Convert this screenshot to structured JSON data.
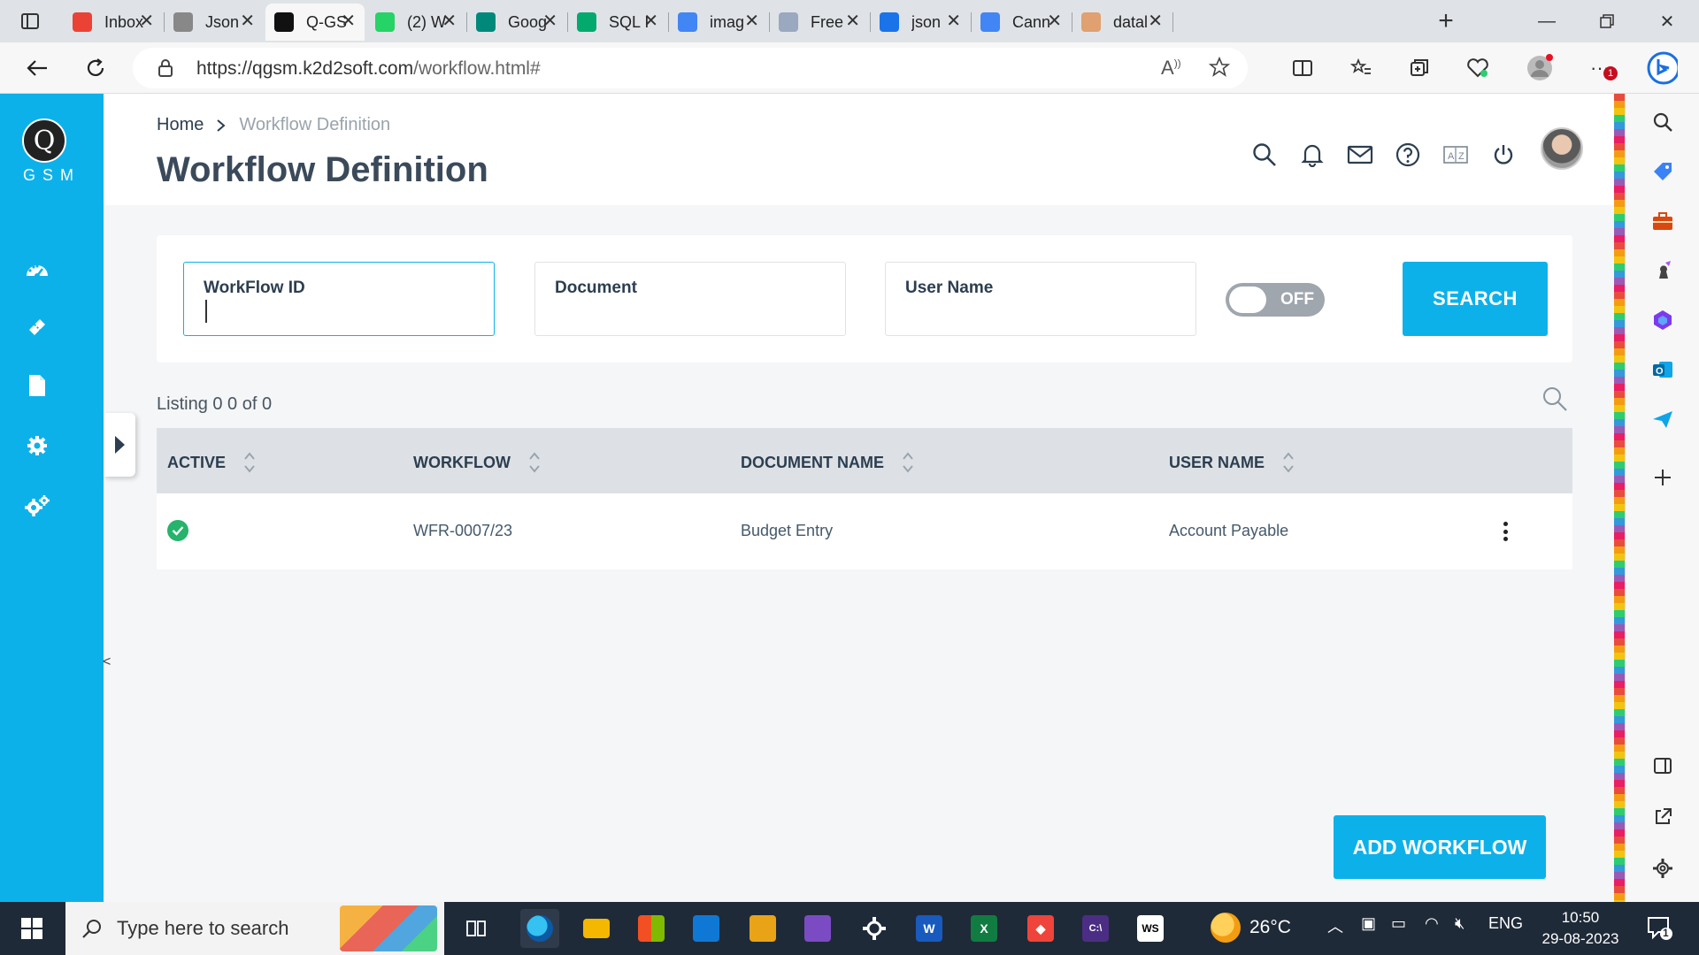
{
  "browser": {
    "tabs": [
      {
        "title": "Inbox",
        "icon": "gmail-icon",
        "color": "#ea4335"
      },
      {
        "title": "Json",
        "icon": "json-icon",
        "color": "#888888"
      },
      {
        "title": "Q-GS",
        "icon": "qgsm-icon",
        "color": "#111111",
        "active": true
      },
      {
        "title": "(2) W",
        "icon": "whatsapp-icon",
        "color": "#25d366"
      },
      {
        "title": "Goog",
        "icon": "google-meet-icon",
        "color": "#00897b"
      },
      {
        "title": "SQL I",
        "icon": "w3schools-icon",
        "color": "#04aa6d"
      },
      {
        "title": "imag",
        "icon": "search-tab-icon",
        "color": "#4285f4"
      },
      {
        "title": "Free",
        "icon": "rp-icon",
        "color": "#9aa8c0"
      },
      {
        "title": "json",
        "icon": "search-tab-icon",
        "color": "#1a73e8"
      },
      {
        "title": "Cann",
        "icon": "search-tab-icon",
        "color": "#4285f4"
      },
      {
        "title": "datal",
        "icon": "doc-tab-icon",
        "color": "#e0a070"
      }
    ],
    "url_host": "https://qgsm.k2d2soft.com",
    "url_path": "/workflow.html#",
    "notification_badge": "1"
  },
  "app": {
    "logo_letter": "Q",
    "logo_text": "GSM",
    "breadcrumb": {
      "home": "Home",
      "separator": ">",
      "current": "Workflow Definition"
    },
    "page_title": "Workflow Definition",
    "header_icons": [
      "search-icon",
      "bell-icon",
      "mail-icon",
      "help-icon",
      "translate-icon",
      "power-icon"
    ],
    "sidebar_icons": [
      "dashboard-icon",
      "ticket-icon",
      "document-icon",
      "settings-icon",
      "multi-settings-icon"
    ],
    "collapse_mark": "<"
  },
  "filters": {
    "workflow_id": {
      "label": "WorkFlow ID",
      "value": ""
    },
    "document": {
      "label": "Document",
      "value": ""
    },
    "user_name": {
      "label": "User Name",
      "value": ""
    },
    "toggle": {
      "state": "OFF"
    },
    "search_button": "SEARCH"
  },
  "listing": {
    "summary": "Listing 0 0 of 0",
    "columns": [
      "ACTIVE",
      "WORKFLOW",
      "DOCUMENT NAME",
      "USER NAME"
    ],
    "rows": [
      {
        "active": true,
        "workflow": "WFR-0007/23",
        "document_name": "Budget Entry",
        "user_name": "Account Payable"
      }
    ]
  },
  "add_button": "ADD WORKFLOW",
  "taskbar": {
    "search_placeholder": "Type here to search",
    "temperature": "26°C",
    "language": "ENG",
    "time": "10:50",
    "date": "29-08-2023",
    "notification_count": "1"
  },
  "colors": {
    "accent": "#0db1ea",
    "active_check": "#26b36b",
    "toggle_off": "#9fa6ad"
  }
}
